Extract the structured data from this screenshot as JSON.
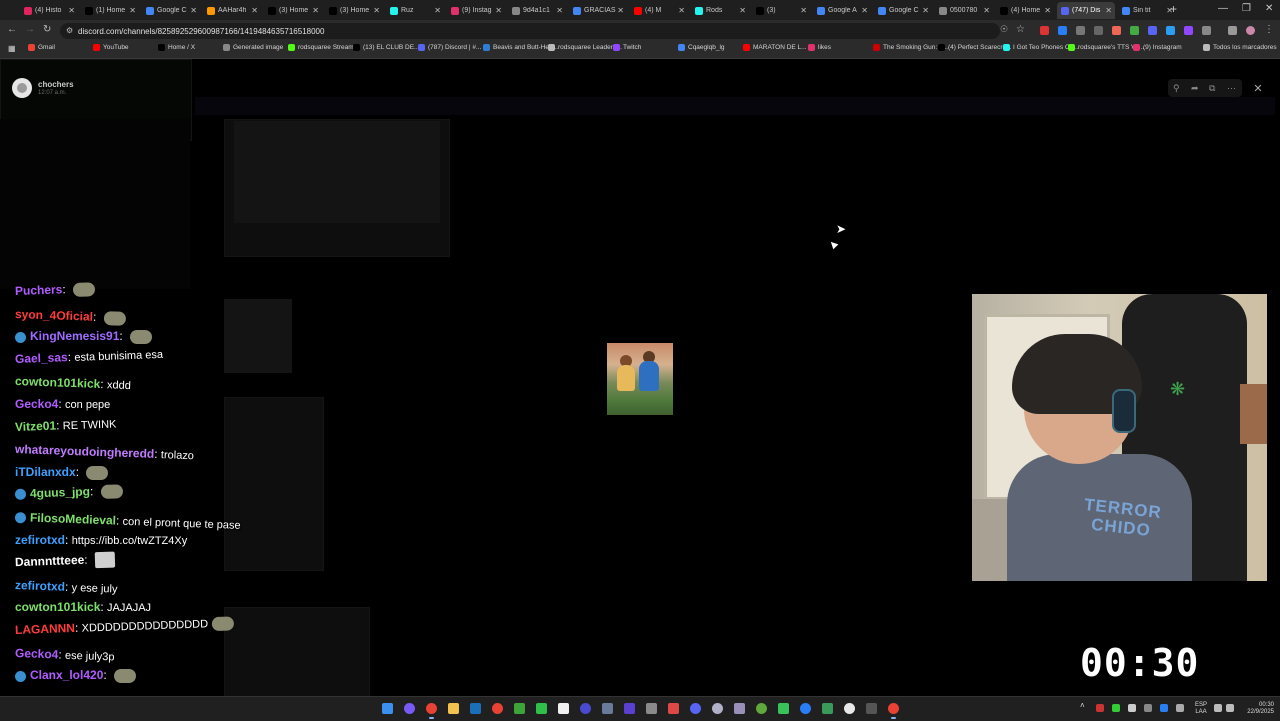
{
  "browser": {
    "tabs": [
      {
        "label": "(4) Histo",
        "color": "#e0245e",
        "active": false
      },
      {
        "label": "(1) Home",
        "color": "#000000",
        "active": false
      },
      {
        "label": "Google C",
        "color": "#4285f4",
        "active": false
      },
      {
        "label": "AAHar4h",
        "color": "#ff9900",
        "active": false
      },
      {
        "label": "(3) Home",
        "color": "#000000",
        "active": false
      },
      {
        "label": "(3) Home",
        "color": "#000000",
        "active": false
      },
      {
        "label": "Ruz",
        "color": "#25f4ee",
        "active": false
      },
      {
        "label": "(9) Instag",
        "color": "#e1306c",
        "active": false
      },
      {
        "label": "9d4a1c1",
        "color": "#888888",
        "active": false
      },
      {
        "label": "GRACIAS",
        "color": "#4285f4",
        "active": false
      },
      {
        "label": "(4) M",
        "color": "#ff0000",
        "active": false
      },
      {
        "label": "Rods",
        "color": "#25f4ee",
        "active": false
      },
      {
        "label": "(3)",
        "color": "#000000",
        "active": false
      },
      {
        "label": "Google A",
        "color": "#4285f4",
        "active": false
      },
      {
        "label": "Google C",
        "color": "#4285f4",
        "active": false
      },
      {
        "label": "0500780",
        "color": "#888888",
        "active": false
      },
      {
        "label": "(4) Home",
        "color": "#000000",
        "active": false
      },
      {
        "label": "(747) Dis",
        "color": "#5865f2",
        "active": true
      },
      {
        "label": "Sin tit",
        "color": "#4285f4",
        "active": false
      }
    ],
    "url": "discord.com/channels/825892529600987166/1419484635716518000",
    "bookmarks": [
      {
        "label": "Gmail",
        "color": "#ea4335"
      },
      {
        "label": "YouTube",
        "color": "#ff0000"
      },
      {
        "label": "Home / X",
        "color": "#000000"
      },
      {
        "label": "Generated image",
        "color": "#888888"
      },
      {
        "label": "rodsquaree Stream...",
        "color": "#53fc18"
      },
      {
        "label": "(13) EL CLUB DE...",
        "color": "#000000"
      },
      {
        "label": "(787) Discord | #...",
        "color": "#5865f2"
      },
      {
        "label": "Beavis and Butt-Hea...",
        "color": "#2e7dd7"
      },
      {
        "label": "rodsquaree Leader8...",
        "color": "#bbbbbb"
      },
      {
        "label": "Twitch",
        "color": "#9146ff"
      },
      {
        "label": "Cqaeglqb_lg",
        "color": "#4285f4"
      },
      {
        "label": "MARATON DE L...",
        "color": "#ff0000"
      },
      {
        "label": "likes",
        "color": "#e1306c"
      },
      {
        "label": "The Smoking Gun: P...",
        "color": "#cc0000"
      },
      {
        "label": "(4) Perfect Scarecro...",
        "color": "#000000"
      },
      {
        "label": "I Got Teo Phones Ch...",
        "color": "#25f4ee"
      },
      {
        "label": "rodsquaree's TTS Vo...",
        "color": "#53fc18"
      },
      {
        "label": "(9) Instagram",
        "color": "#e1306c"
      },
      {
        "label": "Todos los marcadores",
        "color": "#bbbbbb"
      }
    ]
  },
  "viewer": {
    "username": "chochers",
    "timestamp": "12:07 a.m."
  },
  "chat": [
    {
      "nick": "Puchers",
      "color": "#b05cff",
      "msg": "",
      "emote": "pepe",
      "badge": false
    },
    {
      "nick": "syon_4Oficial",
      "color": "#ff3b3b",
      "msg": "",
      "emote": "pepe",
      "badge": false
    },
    {
      "nick": "KingNemesis91",
      "color": "#a06bff",
      "msg": "",
      "emote": "pepe",
      "badge": true
    },
    {
      "nick": "Gael_sas",
      "color": "#b05cff",
      "msg": "esta bunisima esa",
      "emote": "",
      "badge": false
    },
    {
      "nick": "cowton101kick",
      "color": "#7ee06b",
      "msg": "xddd",
      "emote": "",
      "badge": false
    },
    {
      "nick": "Gecko4",
      "color": "#b05cff",
      "msg": "con pepe",
      "emote": "",
      "badge": false
    },
    {
      "nick": "Vitze01",
      "color": "#7ee06b",
      "msg": "RE TWINK",
      "emote": "",
      "badge": false
    },
    {
      "nick": "whatareyoudoingheredd",
      "color": "#c07cff",
      "msg": "trolazo",
      "emote": "",
      "badge": false
    },
    {
      "nick": "iTDilanxdx",
      "color": "#3fa0ff",
      "msg": "",
      "emote": "pepe",
      "badge": false
    },
    {
      "nick": "4guus_jpg",
      "color": "#7ee06b",
      "msg": "",
      "emote": "pepe",
      "badge": true
    },
    {
      "nick": "FilosoMedieval",
      "color": "#7ee06b",
      "msg": "con el pront que te pase",
      "emote": "",
      "badge": true
    },
    {
      "nick": "zefirotxd",
      "color": "#3fa0ff",
      "msg": "https://ibb.co/twZTZ4Xy",
      "emote": "",
      "badge": false
    },
    {
      "nick": "Dannnttteee",
      "color": "#ffffff",
      "msg": "",
      "emote": "square",
      "badge": false
    },
    {
      "nick": "zefirotxd",
      "color": "#3fa0ff",
      "msg": "y ese july",
      "emote": "",
      "badge": false
    },
    {
      "nick": "cowton101kick",
      "color": "#7ee06b",
      "msg": "JAJAJAJ",
      "emote": "",
      "badge": false
    },
    {
      "nick": "LAGANNN",
      "color": "#ff3b3b",
      "msg": "XDDDDDDDDDDDDDDD",
      "emote": "pepe",
      "badge": false
    },
    {
      "nick": "Gecko4",
      "color": "#b05cff",
      "msg": "ese july3p",
      "emote": "",
      "badge": false
    },
    {
      "nick": "Clanx_lol420",
      "color": "#b05cff",
      "msg": "",
      "emote": "pepe",
      "badge": true
    }
  ],
  "webcam": {
    "shirt_text": "TERROR CHIDO"
  },
  "timer": "00:30",
  "taskbar": {
    "lang": "ESP",
    "region": "LAA",
    "time": "00:30",
    "date": "22/9/2025"
  }
}
